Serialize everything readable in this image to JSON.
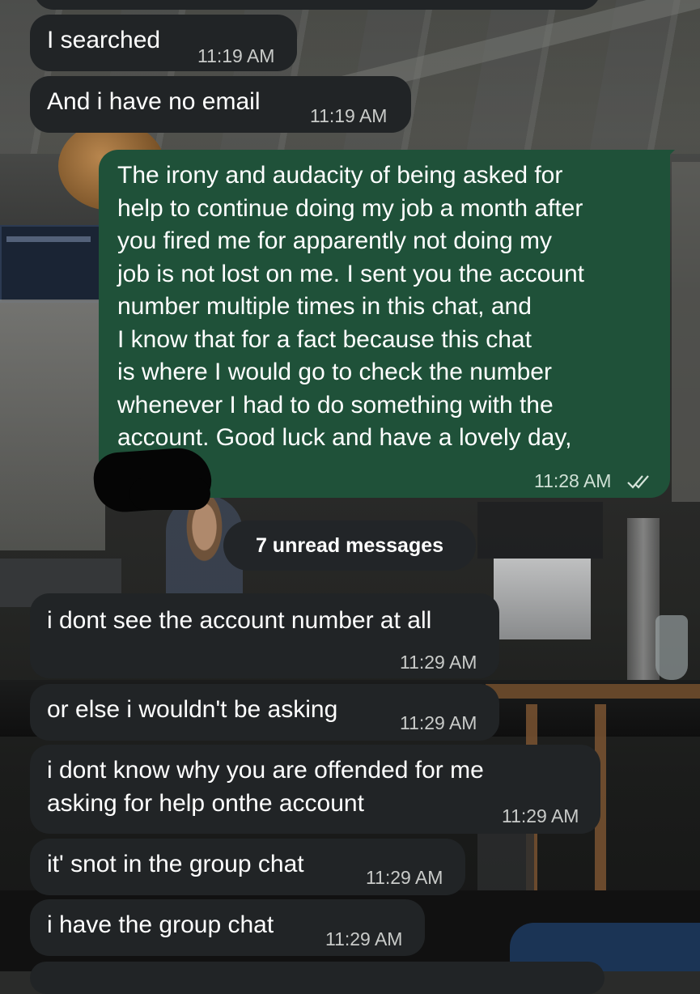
{
  "messages": [
    {
      "text": "I searched",
      "time": "11:19 AM"
    },
    {
      "text": "And i have no email",
      "time": "11:19 AM"
    },
    {
      "lines": [
        "The irony and audacity of being asked for",
        "help to continue doing my job a month after",
        "you fired me for apparently not doing my",
        "job is not lost on me. I sent you the account",
        "number multiple times in this chat, and",
        "I know that for a fact because this chat",
        "is where I would go to check the number",
        "whenever I had to do something with the",
        "account. Good luck and have a lovely day,"
      ],
      "time": "11:28 AM",
      "status": "read"
    },
    {
      "text": "i dont see the account number at all",
      "time": "11:29 AM"
    },
    {
      "text": "or else i wouldn't be asking",
      "time": "11:29 AM"
    },
    {
      "lines": [
        "i dont know why you are offended for me",
        "asking for help onthe account"
      ],
      "time": "11:29 AM"
    },
    {
      "text": "it' snot in the group chat",
      "time": "11:29 AM"
    },
    {
      "text": "i have the group chat",
      "time": "11:29 AM"
    }
  ],
  "unread_divider": "7 unread messages",
  "colors": {
    "incoming_bubble": "#212426",
    "outgoing_bubble": "#1f5139",
    "read_ticks": "#d6e4da"
  },
  "icons": {
    "read_receipt": "double-check-icon"
  }
}
